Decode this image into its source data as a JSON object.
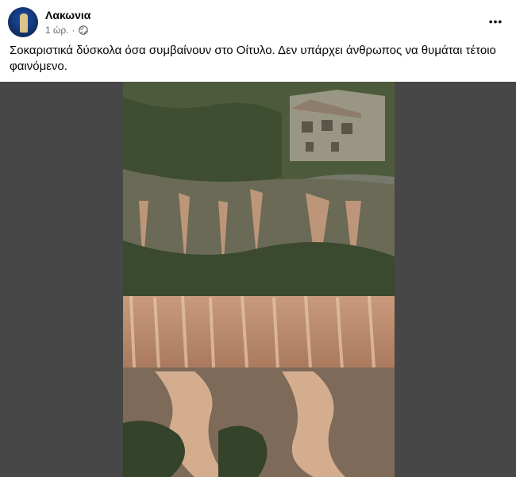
{
  "page": {
    "name": "Λακωνια",
    "time": "1 ώρ.",
    "separator": "·",
    "privacy_icon": "globe-icon",
    "more_icon": "more-options-icon"
  },
  "post": {
    "text": "Σοκαριστικά δύσκολα όσα συμβαίνουν στο Οίτυλο. Δεν υπάρχει άνθρωπος να θυμάται τέτοιο φαινόμενο."
  },
  "colors": {
    "text_primary": "#050505",
    "text_secondary": "#65676b",
    "media_bg": "#474747"
  }
}
